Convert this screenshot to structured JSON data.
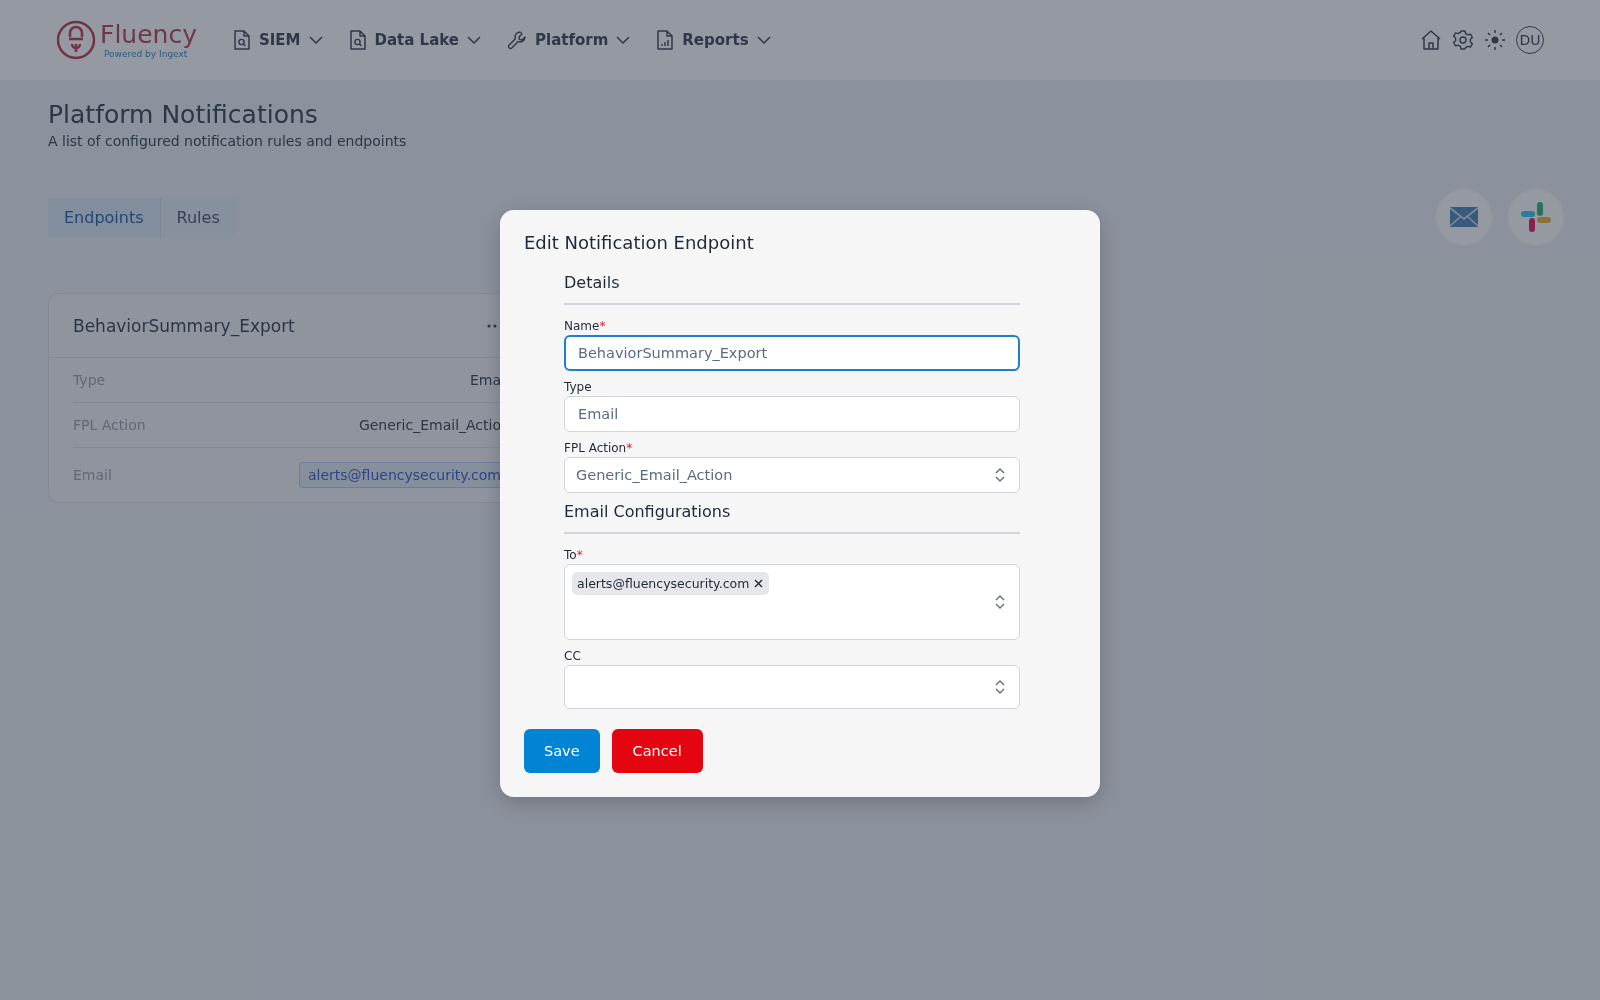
{
  "header": {
    "logo": {
      "name": "Fluency",
      "tagline": "Powered by Ingext"
    },
    "nav": [
      {
        "label": "SIEM",
        "kind": "file-search"
      },
      {
        "label": "Data Lake",
        "kind": "file-search"
      },
      {
        "label": "Platform",
        "kind": "wrench"
      },
      {
        "label": "Reports",
        "kind": "file-chart"
      }
    ],
    "avatar": "DU"
  },
  "page": {
    "title": "Platform Notifications",
    "subtitle": "A list of configured notification rules and endpoints"
  },
  "tabs": [
    {
      "label": "Endpoints",
      "selected": true
    },
    {
      "label": "Rules",
      "selected": false
    }
  ],
  "card": {
    "title": "BehaviorSummary_Export",
    "rows": [
      {
        "label": "Type",
        "value": "Ema",
        "kind": "text"
      },
      {
        "label": "FPL Action",
        "value": "Generic_Email_Actio",
        "kind": "text"
      },
      {
        "label": "Email",
        "value": "alerts@fluencysecurity.com",
        "kind": "chip"
      }
    ]
  },
  "modal": {
    "title": "Edit Notification Endpoint",
    "sections": [
      {
        "heading": "Details",
        "fields": [
          {
            "label": "Name",
            "required": "*",
            "kind": "input",
            "value": "BehaviorSummary_Export",
            "focused": true
          },
          {
            "label": "Type",
            "kind": "input",
            "value": "Email",
            "focused": false
          },
          {
            "label": "FPL Action",
            "required": "*",
            "kind": "select",
            "value": "Generic_Email_Action"
          }
        ]
      },
      {
        "heading": "Email Configurations",
        "fields": [
          {
            "label": "To",
            "required": "*",
            "kind": "multiselect",
            "chips": [
              "alerts@fluencysecurity.com"
            ]
          },
          {
            "label": "CC",
            "kind": "multiselect"
          }
        ]
      }
    ],
    "buttons": [
      {
        "label": "Save",
        "kind": "primary"
      },
      {
        "label": "Cancel",
        "kind": "danger"
      }
    ]
  }
}
